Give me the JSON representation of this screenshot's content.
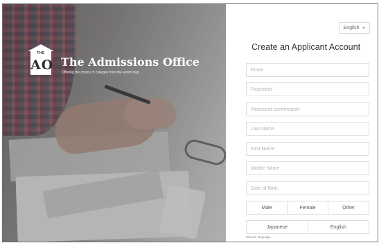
{
  "brand": {
    "logo_small": "THE",
    "logo_letters": "AO",
    "title": "The Admissions Office",
    "tagline": "Offering the choice of colleges from the world map"
  },
  "form": {
    "language_select": "English",
    "title": "Create an Applicant Account",
    "fields": {
      "email": "Email",
      "password": "Password",
      "password_confirmation": "Password confirmation",
      "last_name": "Last Name",
      "first_name": "First Name",
      "middle_name": "Middle Name",
      "date_of_birth": "Date of Birth"
    },
    "gender_options": [
      "Male",
      "Female",
      "Other"
    ],
    "language_options": [
      "Japanese",
      "English"
    ],
    "language_hint": "Choose language"
  },
  "icons": {
    "language_caret": "chevron-down-icon",
    "logo": "building-logo-icon"
  }
}
